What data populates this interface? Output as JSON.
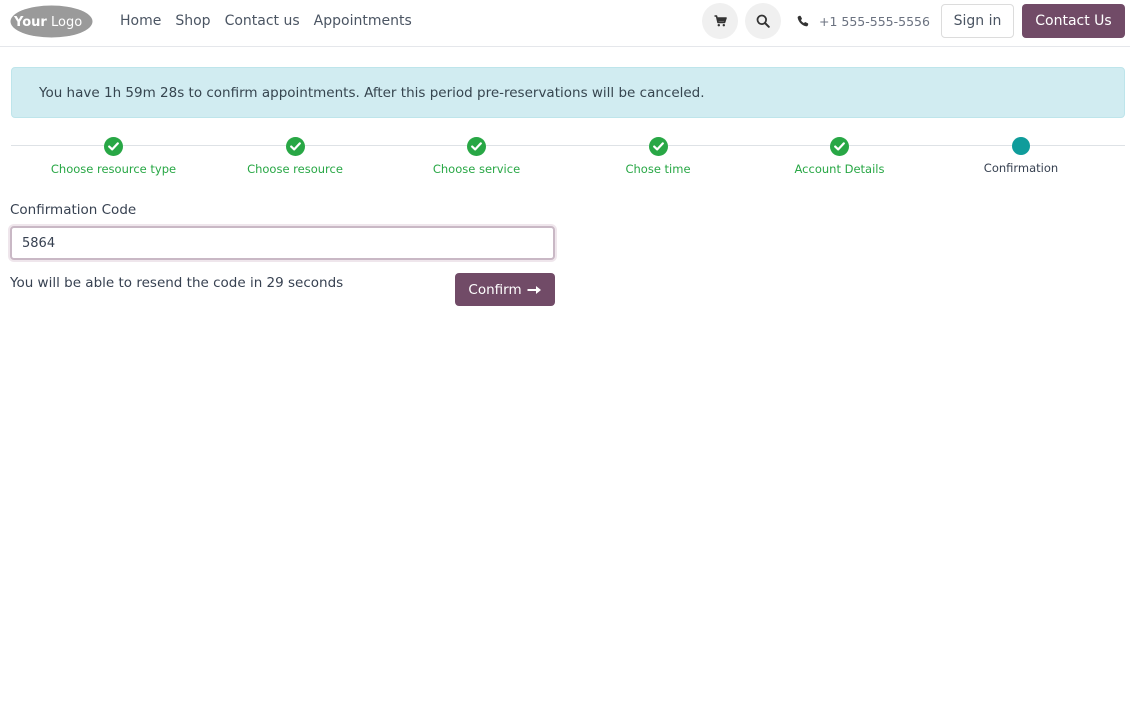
{
  "header": {
    "logo": {
      "text_your": "Your",
      "text_logo": "Logo"
    },
    "nav": [
      "Home",
      "Shop",
      "Contact us",
      "Appointments"
    ],
    "cart_icon": "cart-icon",
    "search_icon": "search-icon",
    "phone_icon": "phone-icon",
    "phone": "+1 555-555-5556",
    "signin_label": "Sign in",
    "contact_label": "Contact Us"
  },
  "alert": {
    "text": "You have 1h 59m 28s to confirm appointments. After this period pre-reservations will be canceled."
  },
  "stepper": {
    "steps": [
      {
        "label": "Choose resource type",
        "status": "done"
      },
      {
        "label": "Choose resource",
        "status": "done"
      },
      {
        "label": "Choose service",
        "status": "done"
      },
      {
        "label": "Chose time",
        "status": "done"
      },
      {
        "label": "Account Details",
        "status": "done"
      },
      {
        "label": "Confirmation",
        "status": "current"
      }
    ]
  },
  "form": {
    "label": "Confirmation Code",
    "code_value": "5864",
    "resend_text": "You will be able to resend the code in 29 seconds",
    "confirm_label": "Confirm",
    "confirm_icon": "arrow-right-icon"
  },
  "colors": {
    "brand": "#714b67",
    "success": "#28a745",
    "current_step": "#0f9c9b",
    "alert_bg": "#d1ecf1"
  }
}
